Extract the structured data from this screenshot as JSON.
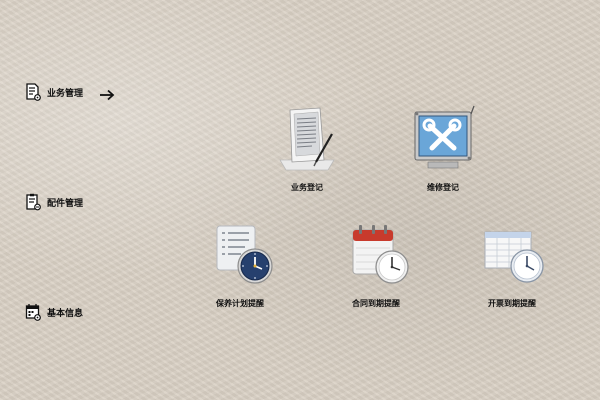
{
  "sidebar": {
    "items": [
      {
        "label": "业务管理",
        "icon": "document-gear-icon",
        "active": true
      },
      {
        "label": "配件管理",
        "icon": "document-parts-icon"
      },
      {
        "label": "基本信息",
        "icon": "calendar-gear-icon"
      }
    ],
    "active_indicator": "arrow-right-icon"
  },
  "tiles": [
    {
      "label": "业务登记",
      "icon": "document-pen-icon"
    },
    {
      "label": "维修登记",
      "icon": "wrench-screwdriver-icon"
    },
    {
      "label": "保养计划提醒",
      "icon": "list-clock-icon"
    },
    {
      "label": "合同到期提醒",
      "icon": "calendar-clock-icon"
    },
    {
      "label": "开票到期提醒",
      "icon": "spreadsheet-clock-icon"
    }
  ],
  "colors": {
    "background": "#d9d0c4",
    "text": "#111111",
    "clock_face_blue": "#26406e",
    "calendar_red": "#c83a2c",
    "monitor_blue": "#6aa6d8"
  }
}
